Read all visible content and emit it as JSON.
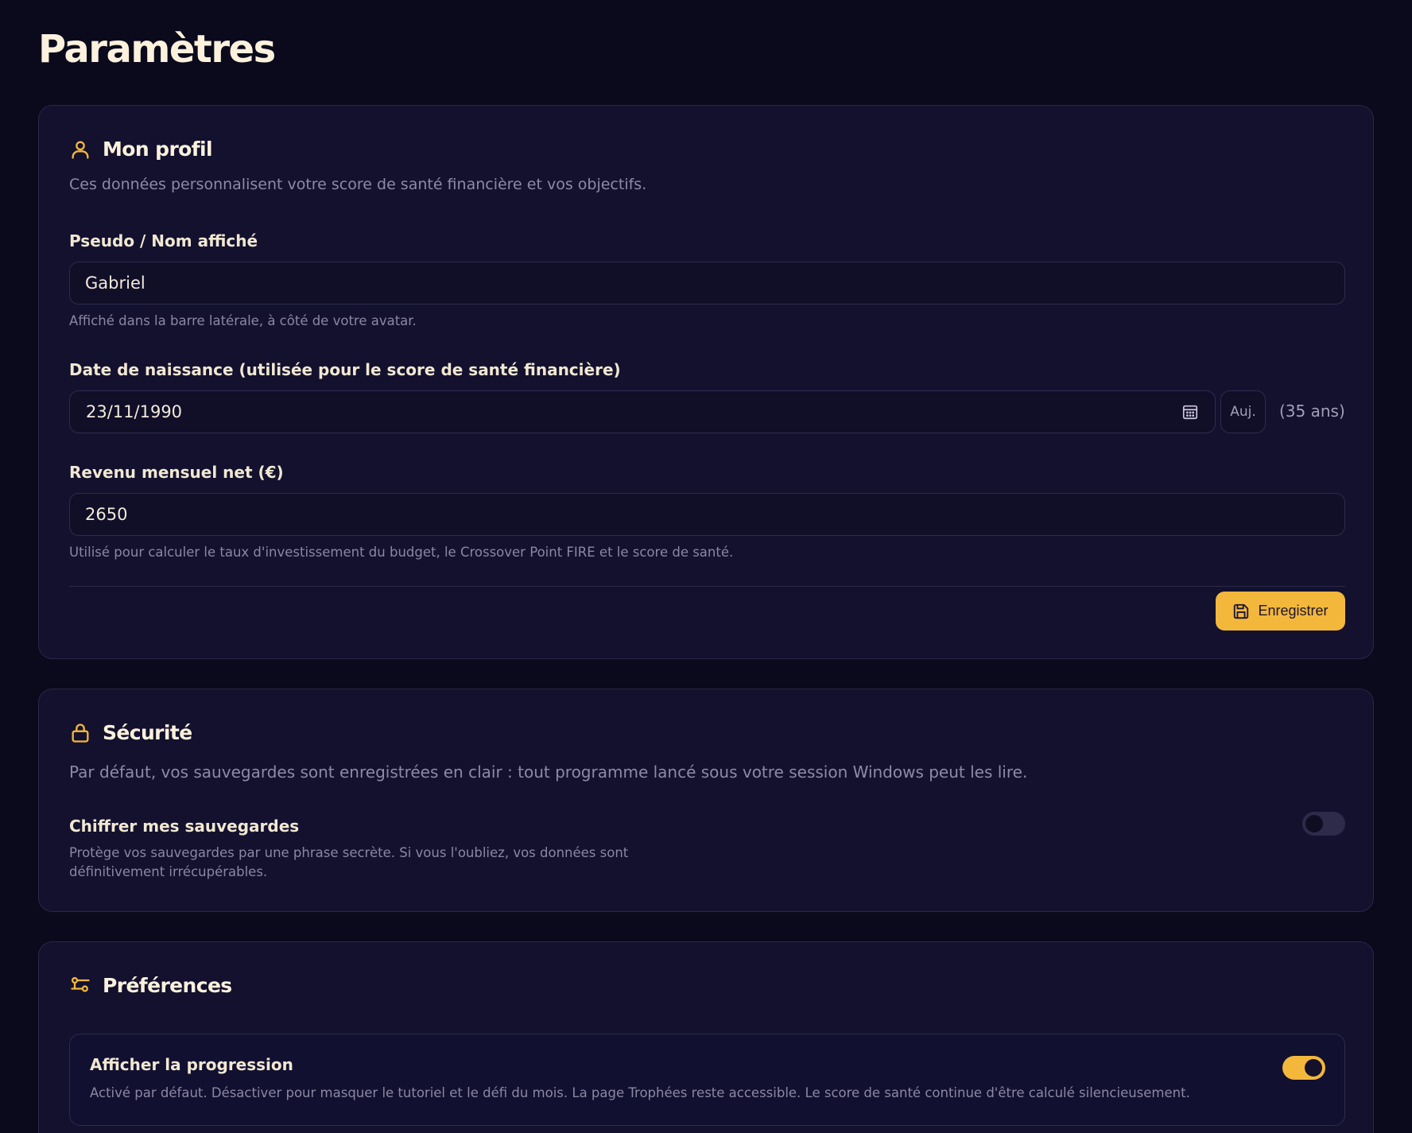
{
  "page": {
    "title": "Paramètres"
  },
  "profile": {
    "title": "Mon profil",
    "icon": "user-icon",
    "description": "Ces données personnalisent votre score de santé financière et vos objectifs.",
    "name_field": {
      "label": "Pseudo / Nom affiché",
      "value": "Gabriel",
      "hint": "Affiché dans la barre latérale, à côté de votre avatar."
    },
    "birthdate_field": {
      "label": "Date de naissance (utilisée pour le score de santé financière)",
      "value": "23/11/1990",
      "today_label": "Auj.",
      "age_text": "(35 ans)"
    },
    "income_field": {
      "label": "Revenu mensuel net (€)",
      "value": "2650",
      "hint": "Utilisé pour calculer le taux d'investissement du budget, le Crossover Point FIRE et le score de santé."
    },
    "save_label": "Enregistrer"
  },
  "security": {
    "title": "Sécurité",
    "icon": "lock-icon",
    "description": "Par défaut, vos sauvegardes sont enregistrées en clair : tout programme lancé sous votre session Windows peut les lire.",
    "encrypt": {
      "title": "Chiffrer mes sauvegardes",
      "description_line1": "Protège vos sauvegardes par une phrase secrète. Si vous l'oubliez, vos données sont",
      "description_line2": "définitivement irrécupérables.",
      "enabled": false
    }
  },
  "preferences": {
    "title": "Préférences",
    "icon": "sliders-icon",
    "progression": {
      "title": "Afficher la progression",
      "description": "Activé par défaut. Désactiver pour masquer le tutoriel et le défi du mois. La page Trophées reste accessible. Le score de santé continue d'être calculé silencieusement.",
      "enabled": true
    }
  },
  "colors": {
    "background": "#0b0a1c",
    "card": "#13112e",
    "accent": "#f3b73c",
    "text": "#f5ecd6",
    "muted": "#8e8aa6"
  }
}
